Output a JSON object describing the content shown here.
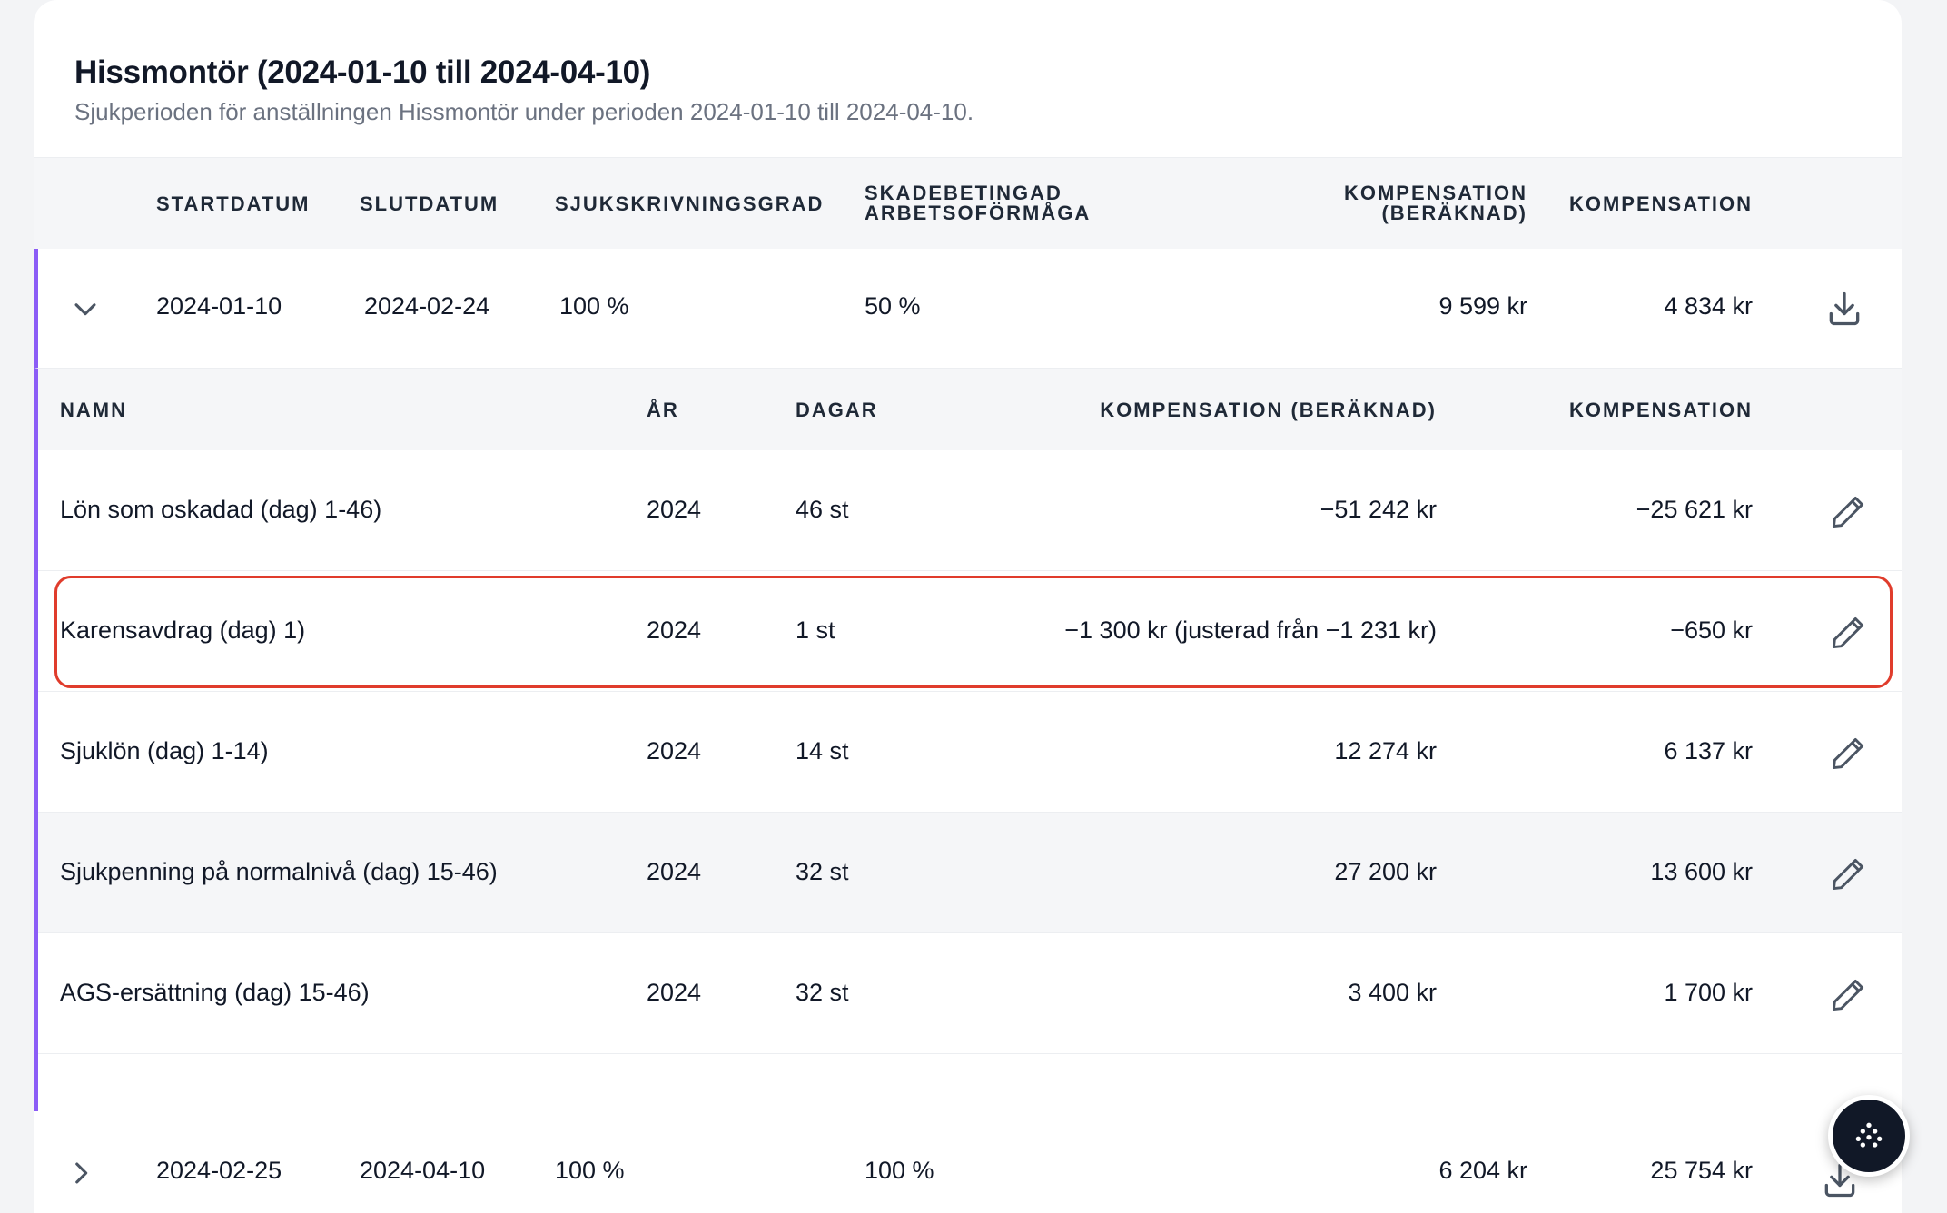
{
  "header": {
    "title": "Hissmontör (2024-01-10 till 2024-04-10)",
    "subtitle": "Sjukperioden för anställningen Hissmontör under perioden 2024-01-10 till 2024-04-10."
  },
  "columns": {
    "start": "STARTDATUM",
    "end": "SLUTDATUM",
    "degree": "SJUKSKRIVNINGSGRAD",
    "work_ability_1": "SKADEBETINGAD",
    "work_ability_2": "ARBETSOFÖRMÅGA",
    "comp_calc_1": "KOMPENSATION",
    "comp_calc_2": "(BERÄKNAD)",
    "comp": "KOMPENSATION"
  },
  "periods": [
    {
      "start": "2024-01-10",
      "end": "2024-02-24",
      "degree": "100 %",
      "work_ability": "50 %",
      "comp_calc": "9 599 kr",
      "comp": "4 834 kr",
      "expanded": true
    },
    {
      "start": "2024-02-25",
      "end": "2024-04-10",
      "degree": "100 %",
      "work_ability": "100 %",
      "comp_calc": "6 204 kr",
      "comp": "25 754 kr",
      "expanded": false
    }
  ],
  "detail_columns": {
    "name": "NAMN",
    "year": "ÅR",
    "days": "DAGAR",
    "comp_calc": "KOMPENSATION (BERÄKNAD)",
    "comp": "KOMPENSATION"
  },
  "detail_rows": [
    {
      "name": "Lön som oskadad (dag) 1-46)",
      "year": "2024",
      "days": "46 st",
      "comp_calc": "−51 242 kr",
      "comp": "−25 621 kr"
    },
    {
      "name": "Karensavdrag (dag) 1)",
      "year": "2024",
      "days": "1 st",
      "comp_calc": "−1 300 kr (justerad från −1 231 kr)",
      "comp": "−650 kr"
    },
    {
      "name": "Sjuklön (dag) 1-14)",
      "year": "2024",
      "days": "14 st",
      "comp_calc": "12 274 kr",
      "comp": "6 137 kr"
    },
    {
      "name": "Sjukpenning på normalnivå (dag) 15-46)",
      "year": "2024",
      "days": "32 st",
      "comp_calc": "27 200 kr",
      "comp": "13 600 kr"
    },
    {
      "name": "AGS-ersättning (dag) 15-46)",
      "year": "2024",
      "days": "32 st",
      "comp_calc": "3 400 kr",
      "comp": "1 700 kr"
    }
  ],
  "icons": {
    "collapse": "chevron-down-icon",
    "expand": "chevron-right-icon",
    "download": "download-icon",
    "edit": "pencil-icon",
    "fab": "grid-dots-icon"
  },
  "colors": {
    "accent": "#8b5cf6",
    "highlight": "#e03c2c",
    "fab": "#111827"
  }
}
